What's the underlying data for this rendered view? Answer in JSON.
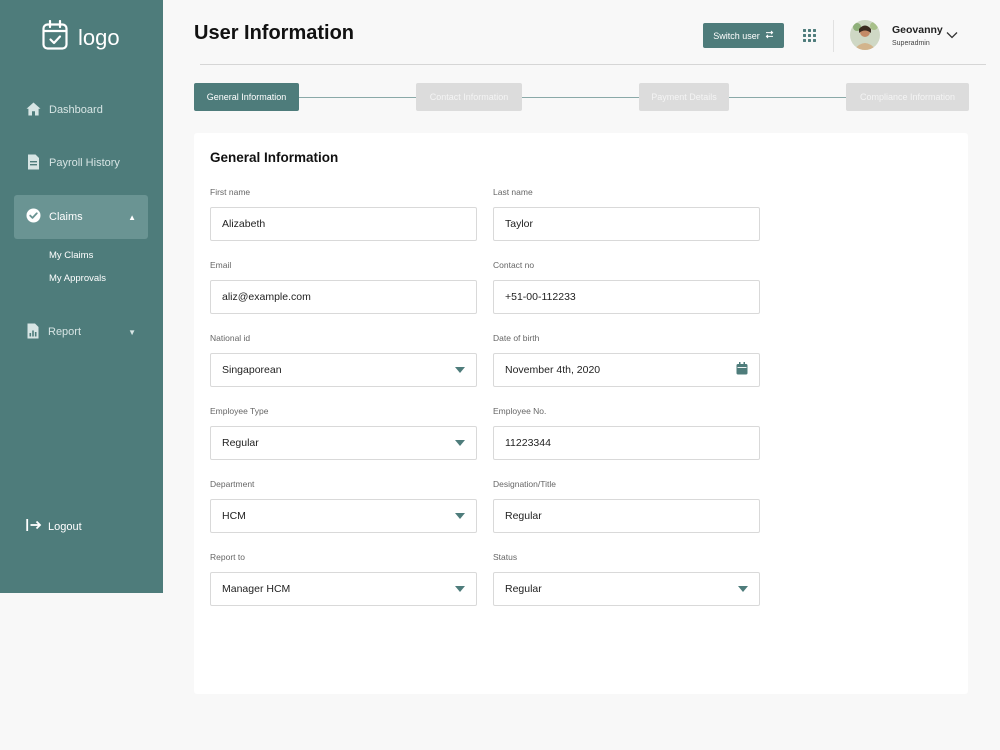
{
  "app": {
    "logo_text": "logo"
  },
  "sidebar": {
    "items": [
      {
        "label": "Dashboard",
        "icon": "home-icon"
      },
      {
        "label": "Payroll History",
        "icon": "document-icon"
      },
      {
        "label": "Claims",
        "icon": "check-circle-icon",
        "active": true
      },
      {
        "label": "Report",
        "icon": "report-icon"
      }
    ],
    "claims_sub": [
      "My Claims",
      "My Approvals"
    ],
    "logout_label": "Logout"
  },
  "header": {
    "title": "User Information",
    "switch_user_label": "Switch user",
    "user_name": "Geovanny",
    "user_role": "Superadmin"
  },
  "steps": [
    "General Information",
    "Contact Information",
    "Payment Details",
    "Compliance Information"
  ],
  "form": {
    "title": "General Information",
    "fields": [
      {
        "label": "First name",
        "value": "Alizabeth",
        "type": "text"
      },
      {
        "label": "Last name",
        "value": "Taylor",
        "type": "text"
      },
      {
        "label": "Email",
        "value": "aliz@example.com",
        "type": "text"
      },
      {
        "label": "Contact no",
        "value": "+51-00-112233",
        "type": "text"
      },
      {
        "label": "National id",
        "value": "Singaporean",
        "type": "select"
      },
      {
        "label": "Date of birth",
        "value": "November 4th, 2020",
        "type": "date"
      },
      {
        "label": "Employee Type",
        "value": "Regular",
        "type": "select"
      },
      {
        "label": "Employee No.",
        "value": "11223344",
        "type": "text"
      },
      {
        "label": "Department",
        "value": "HCM",
        "type": "select"
      },
      {
        "label": "Designation/Title",
        "value": "Regular",
        "type": "text"
      },
      {
        "label": "Report to",
        "value": "Manager HCM",
        "type": "select"
      },
      {
        "label": "Status",
        "value": "Regular",
        "type": "select"
      }
    ]
  },
  "colors": {
    "accent": "#4e7c7b",
    "accent_light": "#6a9493",
    "inactive_step": "#dcdcdc"
  }
}
